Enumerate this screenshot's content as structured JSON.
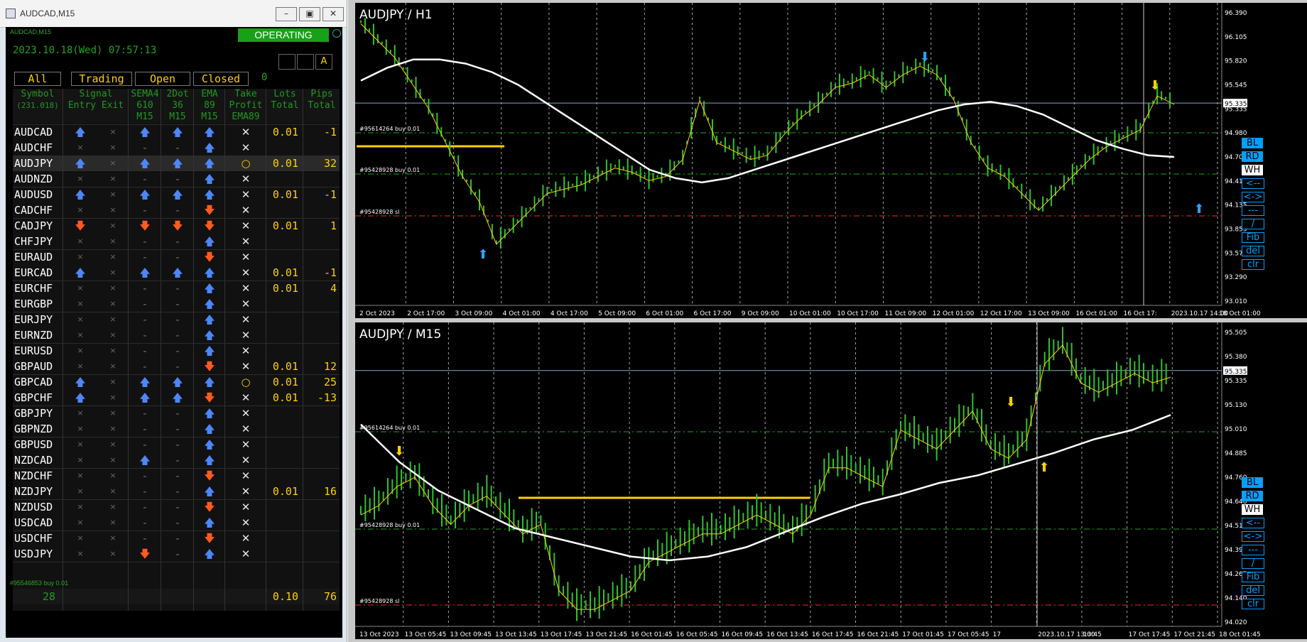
{
  "window": {
    "title": "AUDCAD,M15",
    "panel_label": "AUDCAD,M15"
  },
  "status": {
    "badge": "OPERATING",
    "datetime": "2023.10.18(Wed) 07:57:13",
    "footer_ticket": "#95546853 buy 0.01"
  },
  "buttons": {
    "a_label": "A"
  },
  "tabs": [
    "All",
    "Trading",
    "Open",
    "Closed"
  ],
  "tab_count": "0",
  "header": {
    "symbol": "Symbol",
    "symbol_sub": "(231.018)",
    "signal": "Signal",
    "entry": "Entry",
    "exit": "Exit",
    "sema": "SEMA4",
    "sema2": "610",
    "sema3": "M15",
    "dot": "2Dot",
    "dot2": "36",
    "dot3": "M15",
    "ema": "EMA",
    "ema2": "89",
    "ema3": "M15",
    "tp": "Take",
    "tp2": "Profit",
    "tp3": "EMA89",
    "lots": "Lots",
    "lots2": "Total",
    "pips": "Pips",
    "pips2": "Total"
  },
  "rows": [
    {
      "symbol": "AUDCAD",
      "entry": "up",
      "exit": "x",
      "sema": "up",
      "dot": "up",
      "ema": "up",
      "tp": "X",
      "lots": "0.01",
      "pips": "-1"
    },
    {
      "symbol": "AUDCHF",
      "entry": "x",
      "exit": "x",
      "sema": "-",
      "dot": "-",
      "ema": "up",
      "tp": "X",
      "lots": "",
      "pips": ""
    },
    {
      "symbol": "AUDJPY",
      "entry": "up",
      "exit": "x",
      "sema": "up",
      "dot": "up",
      "ema": "up",
      "tp": "O",
      "lots": "0.01",
      "pips": "32",
      "hl": true
    },
    {
      "symbol": "AUDNZD",
      "entry": "x",
      "exit": "x",
      "sema": "-",
      "dot": "-",
      "ema": "up",
      "tp": "X",
      "lots": "",
      "pips": ""
    },
    {
      "symbol": "AUDUSD",
      "entry": "up",
      "exit": "x",
      "sema": "up",
      "dot": "up",
      "ema": "up",
      "tp": "X",
      "lots": "0.01",
      "pips": "-1"
    },
    {
      "symbol": "CADCHF",
      "entry": "x",
      "exit": "x",
      "sema": "-",
      "dot": "-",
      "ema": "dn",
      "tp": "X",
      "lots": "",
      "pips": ""
    },
    {
      "symbol": "CADJPY",
      "entry": "dn",
      "exit": "x",
      "sema": "dn",
      "dot": "dn",
      "ema": "dn",
      "tp": "X",
      "lots": "0.01",
      "pips": "1"
    },
    {
      "symbol": "CHFJPY",
      "entry": "x",
      "exit": "x",
      "sema": "-",
      "dot": "-",
      "ema": "up",
      "tp": "X",
      "lots": "",
      "pips": ""
    },
    {
      "symbol": "EURAUD",
      "entry": "x",
      "exit": "x",
      "sema": "-",
      "dot": "-",
      "ema": "dn",
      "tp": "X",
      "lots": "",
      "pips": ""
    },
    {
      "symbol": "EURCAD",
      "entry": "up",
      "exit": "x",
      "sema": "up",
      "dot": "up",
      "ema": "up",
      "tp": "X",
      "lots": "0.01",
      "pips": "-1"
    },
    {
      "symbol": "EURCHF",
      "entry": "x",
      "exit": "x",
      "sema": "-",
      "dot": "-",
      "ema": "up",
      "tp": "X",
      "lots": "0.01",
      "pips": "4"
    },
    {
      "symbol": "EURGBP",
      "entry": "x",
      "exit": "x",
      "sema": "-",
      "dot": "-",
      "ema": "up",
      "tp": "X",
      "lots": "",
      "pips": ""
    },
    {
      "symbol": "EURJPY",
      "entry": "x",
      "exit": "x",
      "sema": "-",
      "dot": "-",
      "ema": "up",
      "tp": "X",
      "lots": "",
      "pips": ""
    },
    {
      "symbol": "EURNZD",
      "entry": "x",
      "exit": "x",
      "sema": "-",
      "dot": "-",
      "ema": "up",
      "tp": "X",
      "lots": "",
      "pips": ""
    },
    {
      "symbol": "EURUSD",
      "entry": "x",
      "exit": "x",
      "sema": "-",
      "dot": "-",
      "ema": "up",
      "tp": "X",
      "lots": "",
      "pips": ""
    },
    {
      "symbol": "GBPAUD",
      "entry": "x",
      "exit": "x",
      "sema": "-",
      "dot": "-",
      "ema": "dn",
      "tp": "X",
      "lots": "0.01",
      "pips": "12"
    },
    {
      "symbol": "GBPCAD",
      "entry": "up",
      "exit": "x",
      "sema": "up",
      "dot": "up",
      "ema": "up",
      "tp": "O",
      "lots": "0.01",
      "pips": "25"
    },
    {
      "symbol": "GBPCHF",
      "entry": "up",
      "exit": "x",
      "sema": "up",
      "dot": "up",
      "ema": "dn",
      "tp": "X",
      "lots": "0.01",
      "pips": "-13"
    },
    {
      "symbol": "GBPJPY",
      "entry": "x",
      "exit": "x",
      "sema": "-",
      "dot": "-",
      "ema": "up",
      "tp": "X",
      "lots": "",
      "pips": ""
    },
    {
      "symbol": "GBPNZD",
      "entry": "x",
      "exit": "x",
      "sema": "-",
      "dot": "-",
      "ema": "up",
      "tp": "X",
      "lots": "",
      "pips": ""
    },
    {
      "symbol": "GBPUSD",
      "entry": "x",
      "exit": "x",
      "sema": "-",
      "dot": "-",
      "ema": "up",
      "tp": "X",
      "lots": "",
      "pips": ""
    },
    {
      "symbol": "NZDCAD",
      "entry": "x",
      "exit": "x",
      "sema": "up",
      "dot": "-",
      "ema": "up",
      "tp": "X",
      "lots": "",
      "pips": ""
    },
    {
      "symbol": "NZDCHF",
      "entry": "x",
      "exit": "x",
      "sema": "-",
      "dot": "-",
      "ema": "dn",
      "tp": "X",
      "lots": "",
      "pips": ""
    },
    {
      "symbol": "NZDJPY",
      "entry": "x",
      "exit": "x",
      "sema": "-",
      "dot": "-",
      "ema": "up",
      "tp": "X",
      "lots": "0.01",
      "pips": "16"
    },
    {
      "symbol": "NZDUSD",
      "entry": "x",
      "exit": "x",
      "sema": "-",
      "dot": "-",
      "ema": "dn",
      "tp": "X",
      "lots": "",
      "pips": ""
    },
    {
      "symbol": "USDCAD",
      "entry": "x",
      "exit": "x",
      "sema": "-",
      "dot": "-",
      "ema": "up",
      "tp": "X",
      "lots": "",
      "pips": ""
    },
    {
      "symbol": "USDCHF",
      "entry": "x",
      "exit": "x",
      "sema": "-",
      "dot": "-",
      "ema": "dn",
      "tp": "X",
      "lots": "",
      "pips": ""
    },
    {
      "symbol": "USDJPY",
      "entry": "x",
      "exit": "x",
      "sema": "dn",
      "dot": "-",
      "ema": "up",
      "tp": "X",
      "lots": "",
      "pips": ""
    }
  ],
  "totals": {
    "count": "28",
    "lots": "0.10",
    "pips": "76"
  },
  "chart_data": [
    {
      "type": "line",
      "title": "AUDJPY / H1",
      "price_labels": [
        "96.390",
        "96.105",
        "95.820",
        "95.545",
        "95.335",
        "94.980",
        "94.700",
        "94.415",
        "94.135",
        "93.855",
        "93.575",
        "93.290",
        "93.010"
      ],
      "time_labels": [
        "2 Oct 2023",
        "2 Oct 17:00",
        "3 Oct 09:00",
        "4 Oct 01:00",
        "4 Oct 17:00",
        "5 Oct 09:00",
        "6 Oct 01:00",
        "6 Oct 17:00",
        "9 Oct 09:00",
        "10 Oct 01:00",
        "10 Oct 17:00",
        "11 Oct 09:00",
        "12 Oct 01:00",
        "12 Oct 17:00",
        "13 Oct 09:00",
        "16 Oct 01:00",
        "16 Oct 17:",
        "2023.10.17 14:00",
        "18 Oct 01:00"
      ],
      "current_price": "95.335",
      "order_lines": [
        "#95614264 buy 0.01",
        "#95428928 buy 0.01",
        "#95428928 sl"
      ],
      "price_series": [
        96.3,
        96.1,
        95.9,
        95.6,
        95.3,
        94.9,
        94.5,
        94.2,
        93.7,
        93.9,
        94.1,
        94.3,
        94.35,
        94.4,
        94.5,
        94.6,
        94.55,
        94.45,
        94.5,
        94.7,
        95.4,
        94.9,
        94.8,
        94.7,
        94.75,
        95.0,
        95.2,
        95.35,
        95.55,
        95.6,
        95.7,
        95.55,
        95.7,
        95.8,
        95.7,
        95.4,
        94.9,
        94.6,
        94.5,
        94.3,
        94.1,
        94.3,
        94.5,
        94.7,
        94.85,
        94.95,
        95.05,
        95.45,
        95.35
      ],
      "ema_series": [
        95.6,
        95.75,
        95.85,
        95.85,
        95.8,
        95.7,
        95.55,
        95.35,
        95.15,
        94.95,
        94.75,
        94.55,
        94.45,
        94.4,
        94.45,
        94.55,
        94.65,
        94.75,
        94.85,
        94.95,
        95.05,
        95.15,
        95.25,
        95.32,
        95.35,
        95.3,
        95.2,
        95.05,
        94.9,
        94.8,
        94.72,
        94.7
      ],
      "buttons": [
        "BL",
        "RD",
        "WH",
        "<--",
        "<->",
        "---",
        "/",
        "Fib",
        "del",
        "clr"
      ]
    },
    {
      "type": "line",
      "title": "AUDJPY / M15",
      "price_labels": [
        "95.505",
        "95.380",
        "95.335",
        "95.130",
        "95.010",
        "94.885",
        "94.760",
        "94.640",
        "94.515",
        "94.390",
        "94.265",
        "94.140",
        "94.020"
      ],
      "time_labels": [
        "13 Oct 2023",
        "13 Oct 05:45",
        "13 Oct 09:45",
        "13 Oct 13:45",
        "13 Oct 17:45",
        "13 Oct 21:45",
        "16 Oct 01:45",
        "16 Oct 05:45",
        "16 Oct 09:45",
        "16 Oct 13:45",
        "16 Oct 17:45",
        "16 Oct 21:45",
        "17 Oct 01:45",
        "17 Oct 05:45",
        "17",
        "2023.10.17 13:00",
        "13:45",
        "17 Oct 17:45",
        "17 Oct 21:45",
        "18 Oct 01:45"
      ],
      "current_price": "95.335",
      "order_lines": [
        "#95614264 buy 0.01",
        "#95428928 buy 0.01",
        "#95428928 sl"
      ],
      "price_series": [
        94.6,
        94.65,
        94.75,
        94.8,
        94.65,
        94.55,
        94.65,
        94.7,
        94.6,
        94.5,
        94.55,
        94.2,
        94.1,
        94.1,
        94.15,
        94.2,
        94.35,
        94.4,
        94.45,
        94.5,
        94.5,
        94.55,
        94.6,
        94.55,
        94.5,
        94.6,
        94.85,
        94.85,
        94.8,
        94.75,
        95.05,
        95.0,
        94.95,
        95.05,
        95.15,
        94.95,
        94.9,
        95.0,
        95.4,
        95.5,
        95.3,
        95.25,
        95.3,
        95.35,
        95.3,
        95.33
      ],
      "ema_series": [
        95.05,
        94.85,
        94.7,
        94.6,
        94.5,
        94.45,
        94.4,
        94.35,
        94.33,
        94.35,
        94.4,
        94.48,
        94.56,
        94.63,
        94.68,
        94.74,
        94.78,
        94.84,
        94.9,
        94.97,
        95.02,
        95.1
      ]
    }
  ]
}
